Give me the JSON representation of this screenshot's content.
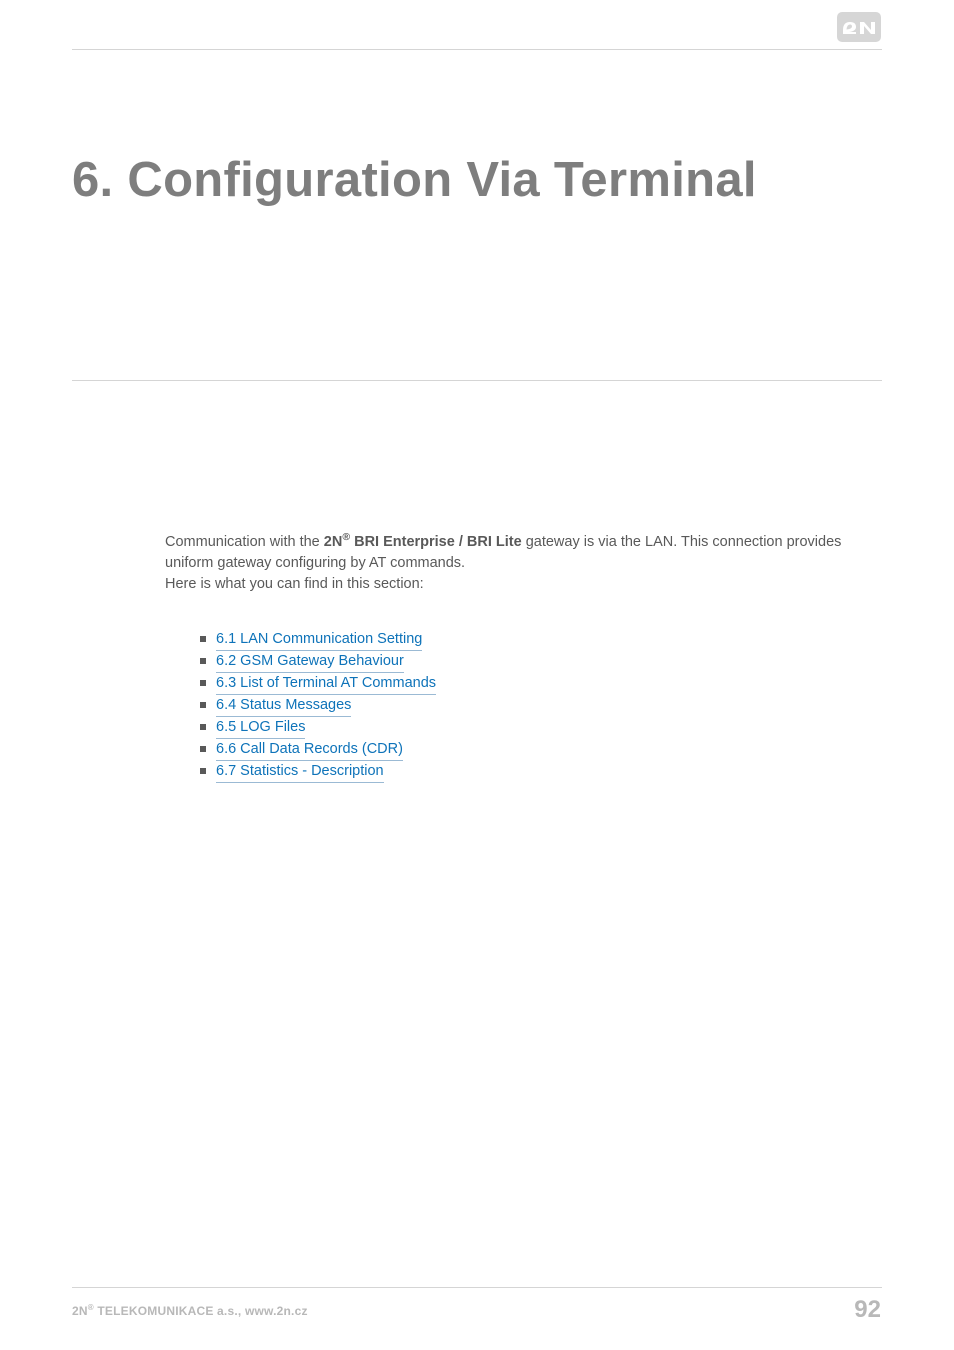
{
  "logo": {
    "name": "2N"
  },
  "title": "6. Configuration Via Terminal",
  "intro": {
    "prefix": "Communication with the ",
    "brand_bold1": "2N",
    "brand_reg": "®",
    "brand_bold2": " BRI Enterprise / BRI Lite",
    "after_brand": " gateway is via the LAN. This connection provides uniform gateway configuring by AT commands.",
    "line2": "Here is what you can find in this section:"
  },
  "toc": [
    "6.1 LAN Communication Setting",
    "6.2 GSM Gateway Behaviour",
    "6.3 List of Terminal AT Commands",
    "6.4 Status Messages",
    "6.5 LOG Files",
    "6.6 Call Data Records (CDR)",
    "6.7 Statistics - Description"
  ],
  "footer": {
    "left_pre": "2N",
    "left_reg": "®",
    "left_post": " TELEKOMUNIKACE a.s., www.2n.cz",
    "page_number": "92"
  }
}
